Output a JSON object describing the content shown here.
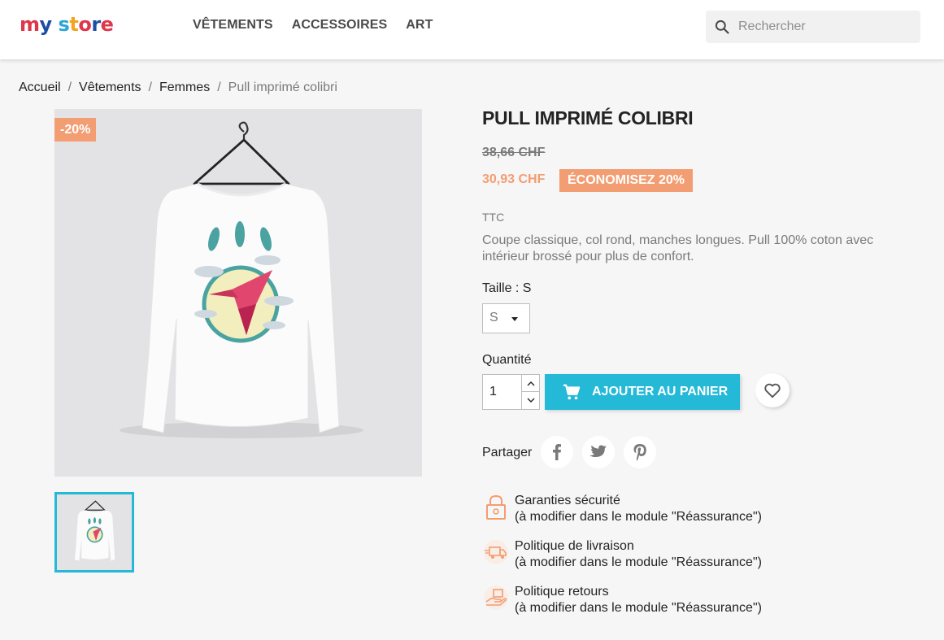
{
  "brand": {
    "letters": [
      {
        "t": "m",
        "c": "#e0364a"
      },
      {
        "t": "y",
        "c": "#1c4fa3"
      },
      {
        "t": " ",
        "c": "#000000"
      },
      {
        "t": "s",
        "c": "#2aa6d6"
      },
      {
        "t": "t",
        "c": "#f4a51f"
      },
      {
        "t": "o",
        "c": "#e0364a"
      },
      {
        "t": "r",
        "c": "#1c4fa3"
      },
      {
        "t": "e",
        "c": "#e0364a"
      }
    ]
  },
  "nav": {
    "items": [
      "VÊTEMENTS",
      "ACCESSOIRES",
      "ART"
    ]
  },
  "search": {
    "placeholder": "Rechercher"
  },
  "breadcrumb": {
    "items": [
      "Accueil",
      "Vêtements",
      "Femmes"
    ],
    "current": "Pull imprimé colibri"
  },
  "product": {
    "flag": "-20%",
    "title": "PULL IMPRIMÉ COLIBRI",
    "regular_price": "38,66 CHF",
    "price": "30,93 CHF",
    "discount": "ÉCONOMISEZ 20%",
    "tax": "TTC",
    "description": "Coupe classique, col rond, manches longues. Pull 100% coton avec intérieur brossé pour plus de confort.",
    "size_label": "Taille : S",
    "size_value": "S",
    "quantity_label": "Quantité",
    "quantity_value": "1",
    "add_to_cart": "AJOUTER AU PANIER",
    "share_label": "Partager"
  },
  "reassurance": [
    {
      "title": "Garanties sécurité",
      "sub": "(à modifier dans le module \"Réassurance\")",
      "icon": "lock-icon"
    },
    {
      "title": "Politique de livraison",
      "sub": "(à modifier dans le module \"Réassurance\")",
      "icon": "truck-icon"
    },
    {
      "title": "Politique retours",
      "sub": "(à modifier dans le module \"Réassurance\")",
      "icon": "return-icon"
    }
  ],
  "colors": {
    "accent": "#24b9d7",
    "discount": "#f39d72"
  }
}
